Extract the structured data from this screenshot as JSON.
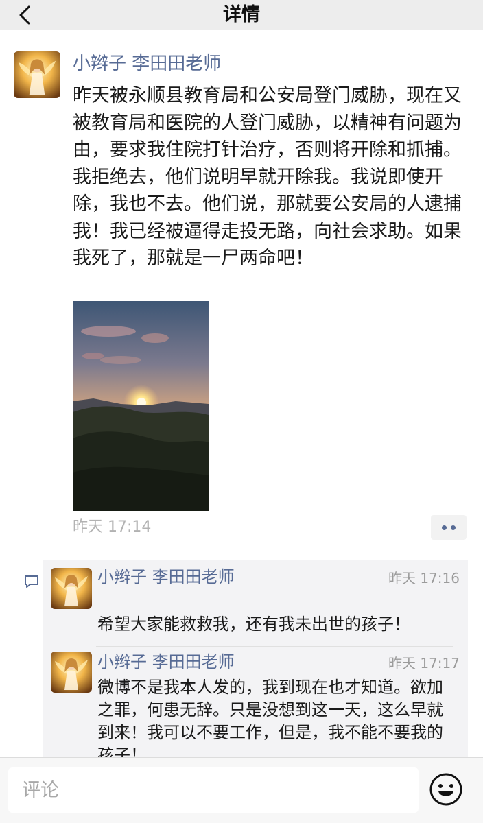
{
  "navbar": {
    "title": "详情",
    "back_icon": "back-chevron-icon"
  },
  "post": {
    "author": "小辫子 李田田老师",
    "text": "昨天被永顺县教育局和公安局登门威胁，现在又被教育局和医院的人登门威胁，以精神有问题为由，要求我住院打针治疗，否则将开除和抓捕。我拒绝去，他们说明早就开除我。我说即使开除，我也不去。他们说，那就要公安局的人逮捕我！我已经被逼得走投无路，向社会求助。如果我死了，那就是一尸两命吧！",
    "time": "昨天 17:14",
    "photo": "sunset-over-mountains",
    "more_icon": "more-dots-icon"
  },
  "comments": [
    {
      "author": "小辫子 李田田老师",
      "time": "昨天 17:16",
      "text": "希望大家能救救我，还有我未出世的孩子！"
    },
    {
      "author": "小辫子 李田田老师",
      "time": "昨天 17:17",
      "text": "微博不是我本人发的，我到现在也才知道。欲加之罪，何患无辞。只是没想到这一天，这么早就到来！我可以不要工作，但是，我不能不要我的孩子！"
    }
  ],
  "input_bar": {
    "placeholder": "评论",
    "emoji_icon": "emoji-smiley-icon"
  },
  "colors": {
    "link_blue": "#576b95",
    "navbar_bg": "#ededed",
    "comment_bg": "#f3f3f5"
  }
}
